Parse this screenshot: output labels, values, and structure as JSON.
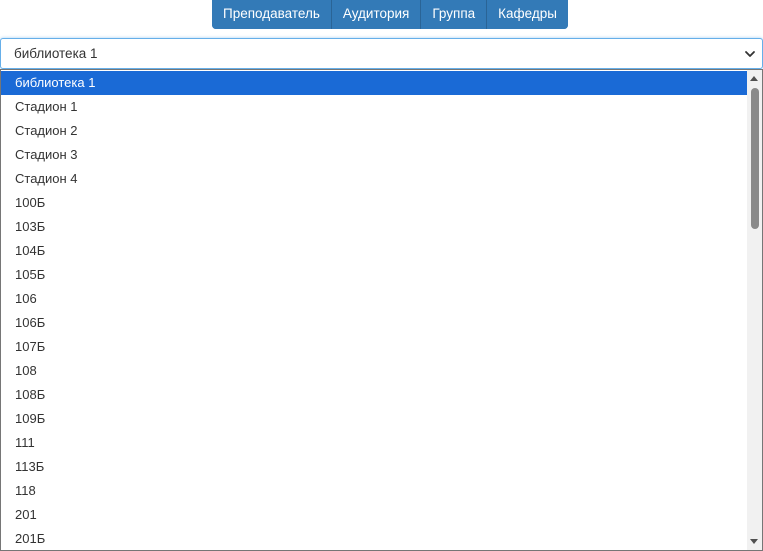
{
  "nav": {
    "buttons": [
      {
        "label": "Преподаватель"
      },
      {
        "label": "Аудитория"
      },
      {
        "label": "Группа"
      },
      {
        "label": "Кафедры"
      }
    ]
  },
  "select": {
    "value": "библиотека 1",
    "options": [
      "библиотека 1",
      "Стадион 1",
      "Стадион 2",
      "Стадион 3",
      "Стадион 4",
      "100Б",
      "103Б",
      "104Б",
      "105Б",
      "106",
      "106Б",
      "107Б",
      "108",
      "108Б",
      "109Б",
      "111",
      "113Б",
      "118",
      "201",
      "201Б"
    ],
    "selected_index": 0
  },
  "colors": {
    "button_bg": "#337ab7",
    "selected_option_bg": "#1a6ad6"
  },
  "icons": {
    "select_arrow": "chevron-down-icon",
    "scroll_up": "arrow-up-icon",
    "scroll_down": "arrow-down-icon"
  }
}
